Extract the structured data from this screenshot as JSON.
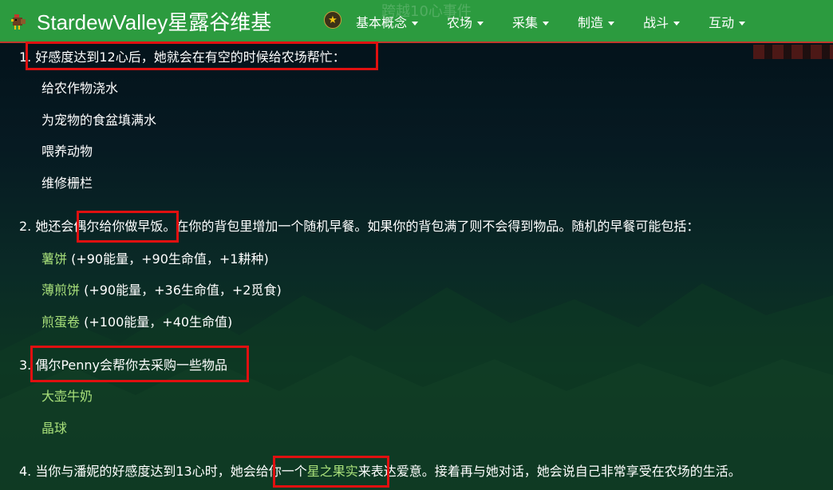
{
  "navbar": {
    "brand": "StardewValley星露谷维基",
    "ghost_heading": "跨越10心事件",
    "menu": [
      {
        "label": "基本概念"
      },
      {
        "label": "农场"
      },
      {
        "label": "采集"
      },
      {
        "label": "制造"
      },
      {
        "label": "战斗"
      },
      {
        "label": "互动"
      }
    ]
  },
  "sections": {
    "s1": {
      "title": "1. 好感度达到12心后，她就会在有空的时候给农场帮忙：",
      "items": [
        "给农作物浇水",
        "为宠物的食盆填满水",
        "喂养动物",
        "维修栅栏"
      ]
    },
    "s2": {
      "prefix": "2. 她还会",
      "highlight": "偶尔给你做早饭",
      "suffix": "。在你的背包里增加一个随机早餐。如果你的背包满了则不会得到物品。随机的早餐可能包括：",
      "items": [
        {
          "name": "薯饼",
          "detail": " (+90能量，+90生命值，+1耕种)"
        },
        {
          "name": "薄煎饼",
          "detail": " (+90能量，+36生命值，+2觅食)"
        },
        {
          "name": "煎蛋卷",
          "detail": " (+100能量，+40生命值)"
        }
      ]
    },
    "s3": {
      "title": "3. 偶尔Penny会帮你去采购一些物品",
      "items": [
        "大壶牛奶",
        "晶球"
      ]
    },
    "s4": {
      "prefix": "4. 当你与潘妮的好感度达到13心时，她会",
      "hl_text": "给你一个",
      "hl_link": "星之果实",
      "suffix": "来表达爱意。接着再与她对话，她会说自己非常享受在农场的生活。"
    }
  },
  "colors": {
    "navbar_bg": "#2c9b3f",
    "link_green": "#a8e07a",
    "highlight_red": "#e01010"
  }
}
